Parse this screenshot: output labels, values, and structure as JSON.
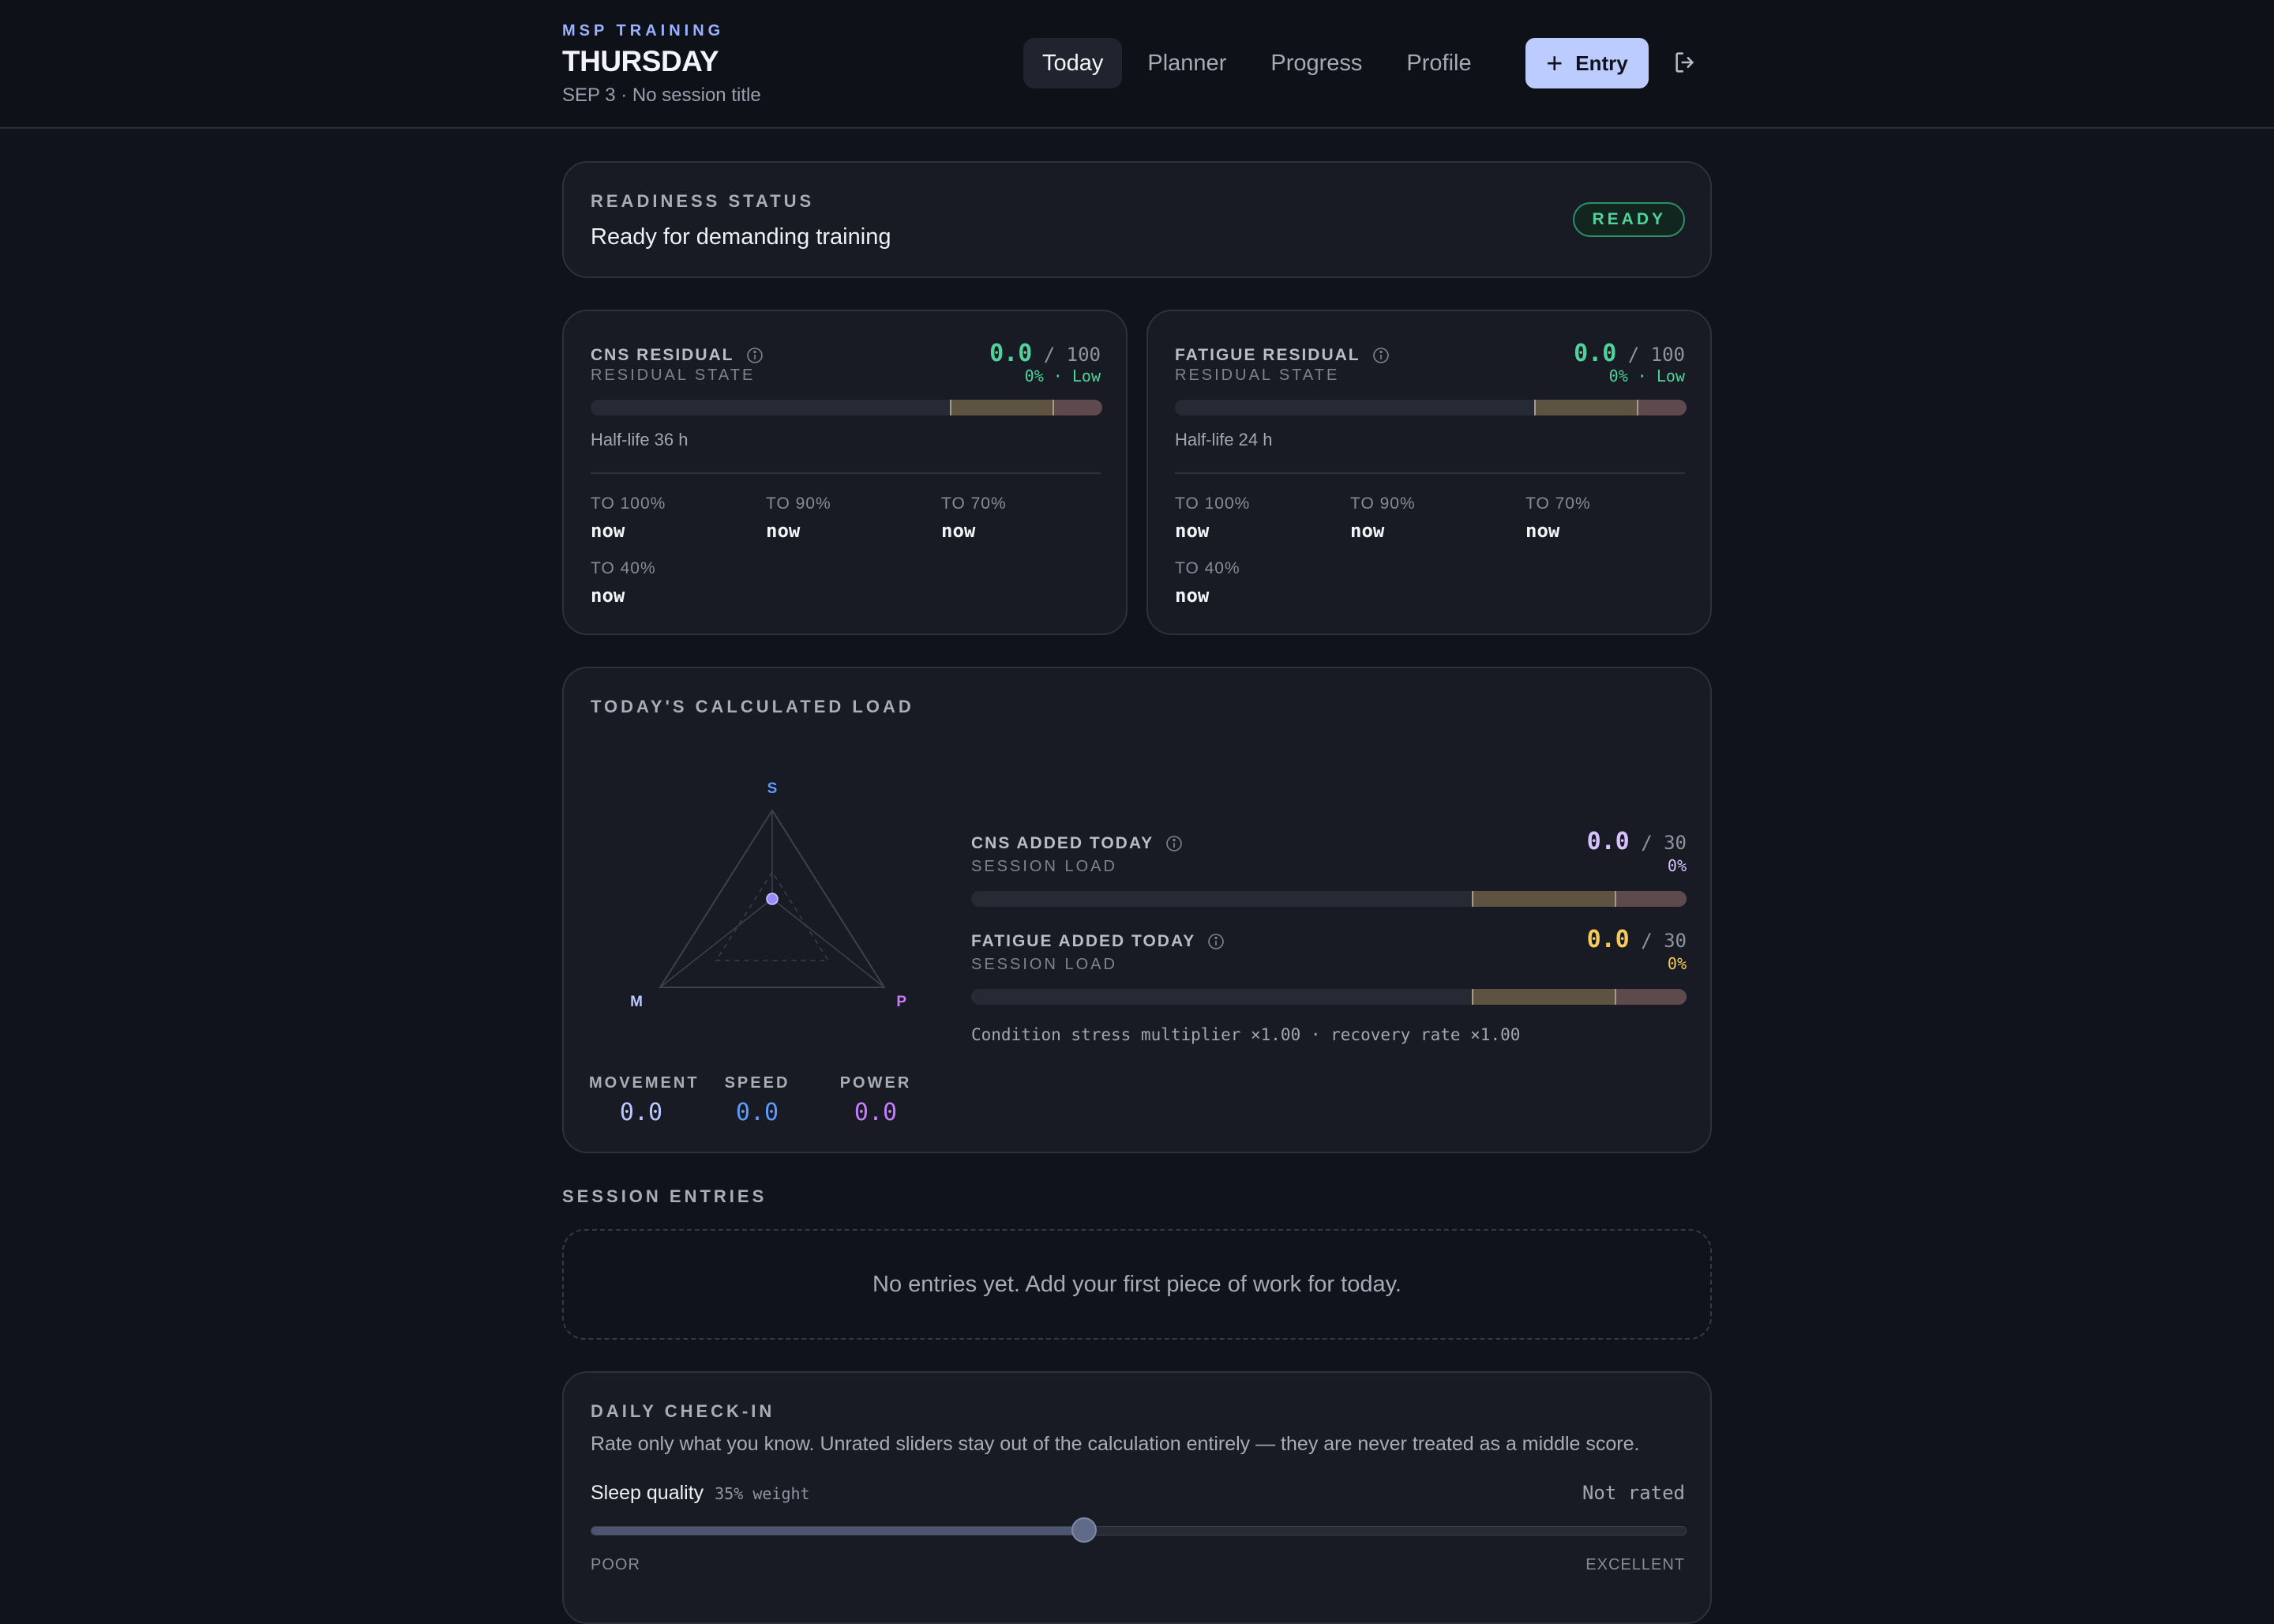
{
  "header": {
    "kicker": "MSP TRAINING",
    "day": "THURSDAY",
    "subtitle": "SEP 3 · No session title",
    "nav": [
      {
        "label": "Today",
        "active": true
      },
      {
        "label": "Planner",
        "active": false
      },
      {
        "label": "Progress",
        "active": false
      },
      {
        "label": "Profile",
        "active": false
      }
    ],
    "entry_label": "Entry",
    "entry_icon": "plus-icon",
    "logout_icon": "logout-icon"
  },
  "readiness": {
    "title": "READINESS STATUS",
    "text": "Ready for demanding training",
    "badge": "READY"
  },
  "residuals": [
    {
      "title": "CNS RESIDUAL",
      "state": "RESIDUAL STATE",
      "value": "0.0",
      "max": "/ 100",
      "pct": "0% · Low",
      "level": 0,
      "half_life": "Half-life 36 h",
      "milestones": [
        {
          "label": "TO 100%",
          "value": "now"
        },
        {
          "label": "TO 90%",
          "value": "now"
        },
        {
          "label": "TO 70%",
          "value": "now"
        },
        {
          "label": "TO 40%",
          "value": "now"
        }
      ]
    },
    {
      "title": "FATIGUE RESIDUAL",
      "state": "RESIDUAL STATE",
      "value": "0.0",
      "max": "/ 100",
      "pct": "0% · Low",
      "level": 0,
      "half_life": "Half-life 24 h",
      "milestones": [
        {
          "label": "TO 100%",
          "value": "now"
        },
        {
          "label": "TO 90%",
          "value": "now"
        },
        {
          "label": "TO 70%",
          "value": "now"
        },
        {
          "label": "TO 40%",
          "value": "now"
        }
      ]
    }
  ],
  "load": {
    "title": "TODAY'S CALCULATED LOAD",
    "radar_axes": [
      "S",
      "M",
      "P"
    ],
    "stats": [
      {
        "label": "MOVEMENT",
        "value": "0.0",
        "color": "#b9c8ff"
      },
      {
        "label": "SPEED",
        "value": "0.0",
        "color": "#5d9bff"
      },
      {
        "label": "POWER",
        "value": "0.0",
        "color": "#c77dff"
      }
    ],
    "added": [
      {
        "title": "CNS ADDED TODAY",
        "sub": "SESSION LOAD",
        "value": "0.0",
        "max": "/ 30",
        "pct": "0%",
        "color": "#d7c2ff",
        "level": 0
      },
      {
        "title": "FATIGUE ADDED TODAY",
        "sub": "SESSION LOAD",
        "value": "0.0",
        "max": "/ 30",
        "pct": "0%",
        "color": "#f5c95a",
        "level": 0
      }
    ],
    "multiplier": "Condition stress multiplier ×1.00 · recovery rate ×1.00"
  },
  "entries": {
    "title": "SESSION ENTRIES",
    "empty": "No entries yet. Add your first piece of work for today."
  },
  "checkin": {
    "title": "DAILY CHECK-IN",
    "description": "Rate only what you know. Unrated sliders stay out of the calculation entirely — they are never treated as a middle score.",
    "slider": {
      "name": "Sleep quality",
      "weight": "35% weight",
      "status": "Not rated",
      "value": 0.45,
      "min_label": "POOR",
      "max_label": "EXCELLENT"
    }
  }
}
